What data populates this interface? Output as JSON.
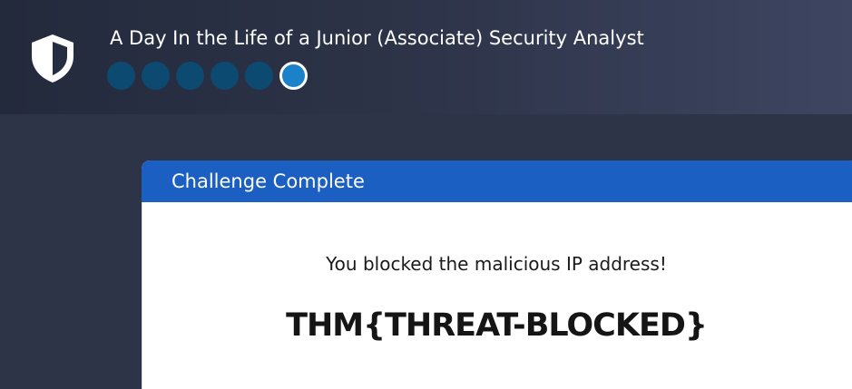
{
  "header": {
    "title": "A Day In the Life of a Junior (Associate) Security Analyst",
    "icon": "shield-icon",
    "progress": {
      "total_steps": 6,
      "current_step": 6,
      "completed_color": "#0d4a72",
      "current_color": "#1b82c9"
    }
  },
  "modal": {
    "title": "Challenge Complete",
    "message": "You blocked the malicious IP address!",
    "flag": "THM{THREAT-BLOCKED}",
    "header_color": "#1a5fc1"
  }
}
